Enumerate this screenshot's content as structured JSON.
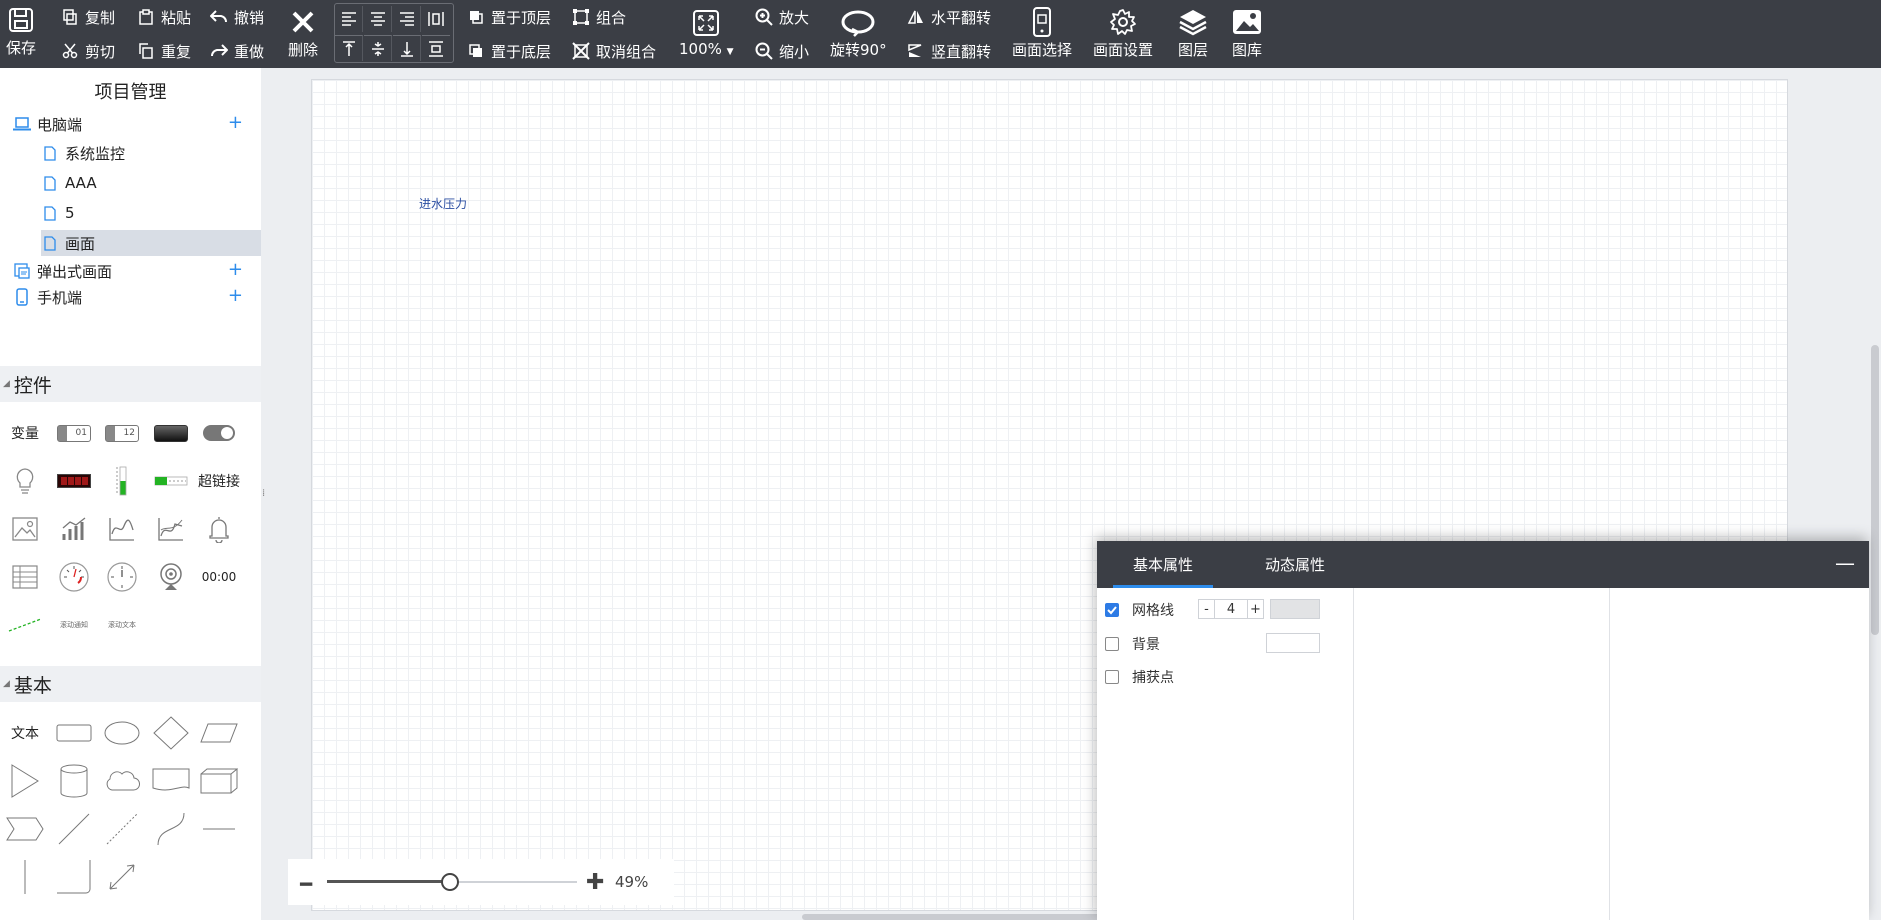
{
  "toolbar": {
    "save": "保存",
    "copy": "复制",
    "paste": "粘贴",
    "undo": "撤销",
    "cut": "剪切",
    "duplicate": "重复",
    "redo": "重做",
    "delete": "删除",
    "bring_front": "置于顶层",
    "send_back": "置于底层",
    "group": "组合",
    "ungroup": "取消组合",
    "zoom_level": "100%",
    "zoom_in": "放大",
    "zoom_out": "缩小",
    "rotate": "旋转90°",
    "flip_h": "水平翻转",
    "flip_v": "竖直翻转",
    "screen_select": "画面选择",
    "screen_settings": "画面设置",
    "layers": "图层",
    "gallery": "图库"
  },
  "project": {
    "title": "项目管理",
    "desktop": "电脑端",
    "pages": [
      "系统监控",
      "AAA",
      "5",
      "画面"
    ],
    "popup": "弹出式画面",
    "mobile": "手机端",
    "add_symbol": "+"
  },
  "controls": {
    "heading": "控件",
    "variable": "变量",
    "hyperlink": "超链接",
    "clock_text": "00:00",
    "tiny_label_1": "滚动通知",
    "tiny_label_2": "滚动文本",
    "display_01": "01",
    "display_12": "12"
  },
  "basic": {
    "heading": "基本",
    "text": "文本"
  },
  "canvas": {
    "label": "进水压力",
    "collapse_handle": "⁞"
  },
  "zoom": {
    "value": "49%",
    "fraction": 0.49
  },
  "properties": {
    "tab_basic": "基本属性",
    "tab_dynamic": "动态属性",
    "close": "—",
    "grid_label": "网格线",
    "grid_minus": "-",
    "grid_value": "4",
    "grid_plus": "+",
    "background_label": "背景",
    "snap_label": "捕获点",
    "grid_checked": true,
    "background_checked": false,
    "snap_checked": false
  },
  "colors": {
    "toolbar_bg": "#3b3e45",
    "accent": "#2d8ceb",
    "canvas_label": "#2b4ea2"
  }
}
